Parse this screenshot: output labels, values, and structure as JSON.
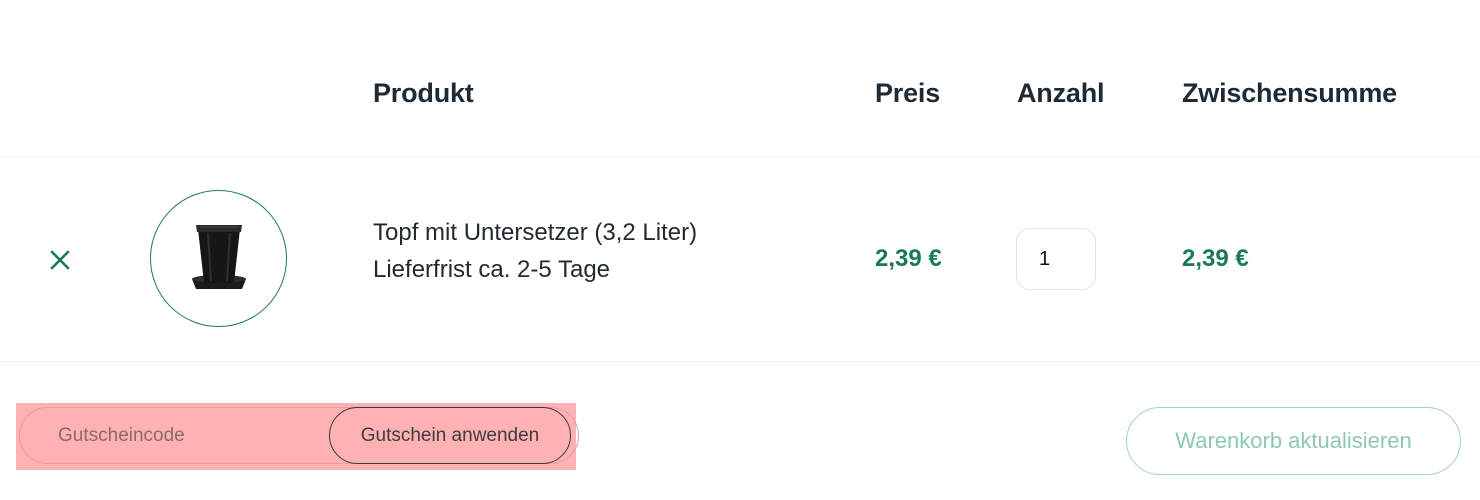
{
  "table": {
    "headers": {
      "product": "Produkt",
      "price": "Preis",
      "quantity": "Anzahl",
      "subtotal": "Zwischensumme"
    }
  },
  "cart_items": [
    {
      "name": "Topf mit Untersetzer (3,2 Liter)",
      "delivery": "Lieferfrist ca. 2-5 Tage",
      "price": "2,39 €",
      "quantity": "1",
      "subtotal": "2,39 €",
      "image_icon": "plant-pot-icon",
      "remove_icon": "close-icon"
    }
  ],
  "coupon": {
    "placeholder": "Gutscheincode",
    "apply_label": "Gutschein anwenden"
  },
  "actions": {
    "update_cart_label": "Warenkorb aktualisieren"
  },
  "colors": {
    "accent": "#1a7a55",
    "highlight": "#ffb1b4",
    "update_button": "#8fc7b2"
  }
}
